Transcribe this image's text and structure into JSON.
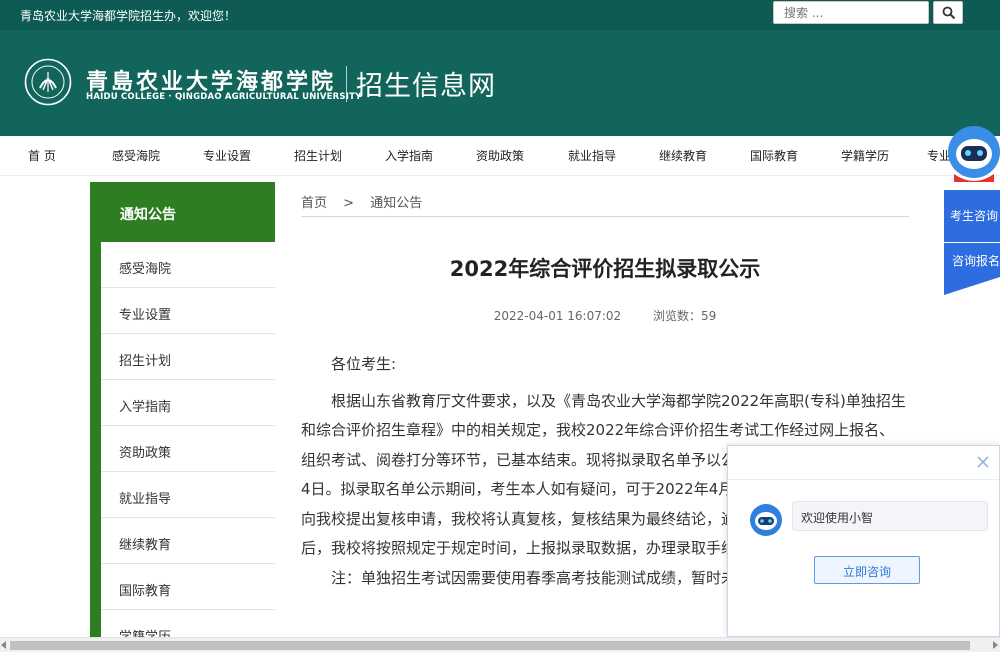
{
  "topbar": {
    "welcome": "青岛农业大学海都学院招生办，欢迎您！",
    "search_placeholder": "搜索 ..."
  },
  "header": {
    "school_name": "青島农业大学海都学院",
    "school_en": "HAIDU COLLEGE · QINGDAO AGRICULTURAL UNIVERSITY",
    "site_title": "招生信息网"
  },
  "nav": {
    "items": [
      "首 页",
      "感受海院",
      "专业设置",
      "招生计划",
      "入学指南",
      "资助政策",
      "就业指导",
      "继续教育",
      "国际教育",
      "学籍学历",
      "专业"
    ]
  },
  "sidebar": {
    "title": "通知公告",
    "items": [
      "感受海院",
      "专业设置",
      "招生计划",
      "入学指南",
      "资助政策",
      "就业指导",
      "继续教育",
      "国际教育",
      "学籍学历"
    ]
  },
  "breadcrumb": {
    "home": "首页",
    "sep": ">",
    "current": "通知公告"
  },
  "article": {
    "title": "2022年综合评价招生拟录取公示",
    "datetime": "2022-04-01 16:07:02",
    "views": "浏览数：59",
    "greeting": "各位考生:",
    "para1": "根据山东省教育厅文件要求，以及《青岛农业大学海都学院2022年高职(专科)单独招生和综合评价招生章程》中的相关规定，我校2022年综合评价招生考试工作经过网上报名、组织考试、阅卷打分等环节，已基本结束。现将拟录取名单予以公示，公示时间为4月2日至4日。拟录取名单公示期间，考生本人如有疑问，可于2022年4月4日17:00前，以书面形式向我校提出复核申请，我校将认真复核，复核结果为最终结论，逾期不予受理。公示结束后，我校将按照规定于规定时间，上报拟录取数据，办理录取手续。",
    "note": "注：单独招生考试因需要使用春季高考技能测试成绩，暂时未公布，请考生耐心等待。"
  },
  "float": {
    "consult_a": "考生咨询",
    "consult_b": "咨询报名"
  },
  "chat": {
    "welcome_msg": "欢迎使用小智",
    "consult_button": "立即咨询"
  },
  "colors": {
    "topbar": "#0d5b52",
    "header": "#11655b",
    "sidebar_green": "#2e7d23",
    "consult_blue": "#2d6de0"
  }
}
